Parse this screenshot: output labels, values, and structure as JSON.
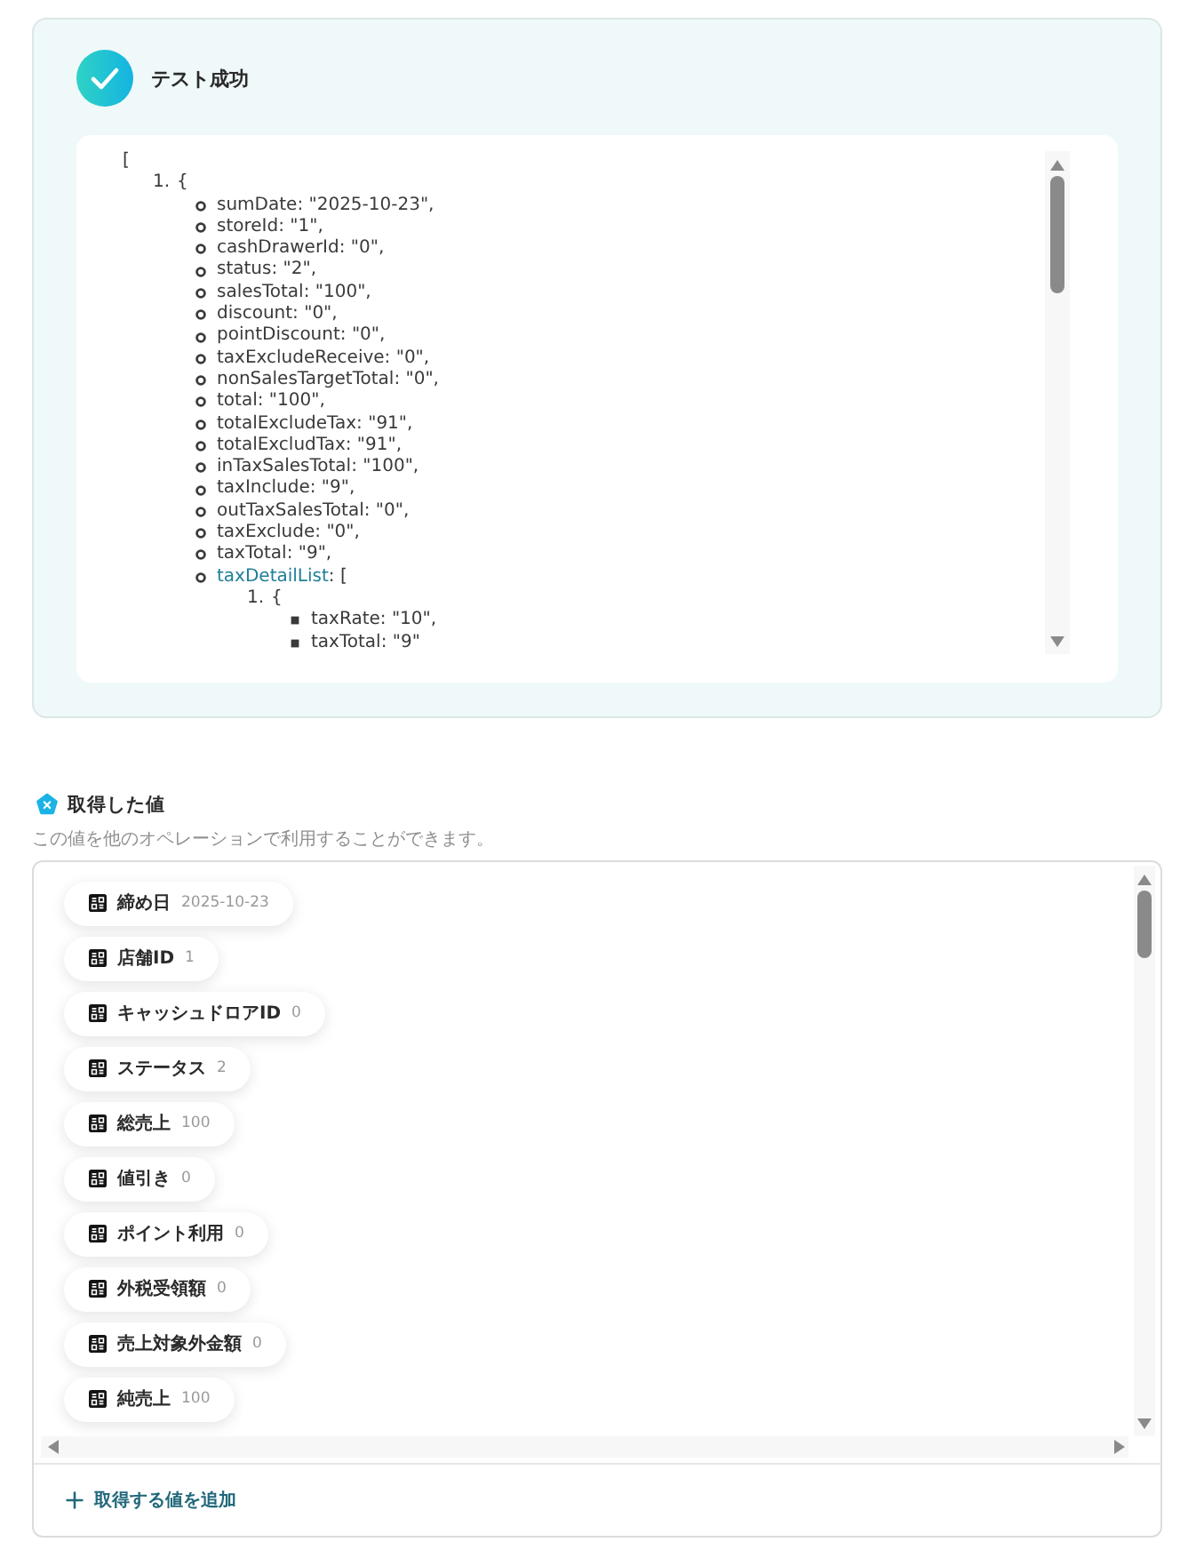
{
  "test_result": {
    "success": true,
    "title": "テスト成功",
    "output": [
      {
        "text": "[",
        "children": [
          {
            "marker": "1.",
            "text": "{",
            "children": [
              {
                "text": "sumDate: \"2025-10-23\","
              },
              {
                "text": "storeId: \"1\","
              },
              {
                "text": "cashDrawerId: \"0\","
              },
              {
                "text": "status: \"2\","
              },
              {
                "text": "salesTotal: \"100\","
              },
              {
                "text": "discount: \"0\","
              },
              {
                "text": "pointDiscount: \"0\","
              },
              {
                "text": "taxExcludeReceive: \"0\","
              },
              {
                "text": "nonSalesTargetTotal: \"0\","
              },
              {
                "text": "total: \"100\","
              },
              {
                "text": "totalExcludeTax: \"91\","
              },
              {
                "text": "totalExcludTax: \"91\","
              },
              {
                "text": "inTaxSalesTotal: \"100\","
              },
              {
                "text": "taxInclude: \"9\","
              },
              {
                "text": "outTaxSalesTotal: \"0\","
              },
              {
                "text": "taxExclude: \"0\","
              },
              {
                "text": "taxTotal: \"9\","
              },
              {
                "link": "taxDetailList",
                "text": ": [",
                "children": [
                  {
                    "marker": "1.",
                    "text": "{",
                    "children": [
                      {
                        "text": "taxRate: \"10\","
                      },
                      {
                        "text": "taxTotal: \"9\""
                      }
                    ]
                  }
                ]
              }
            ]
          }
        ]
      }
    ]
  },
  "acquired_values": {
    "title": "取得した値",
    "description": "この値を他のオペレーションで利用することができます。",
    "items": [
      {
        "label": "締め日",
        "value": "2025-10-23"
      },
      {
        "label": "店舗ID",
        "value": "1"
      },
      {
        "label": "キャッシュドロアID",
        "value": "0"
      },
      {
        "label": "ステータス",
        "value": "2"
      },
      {
        "label": "総売上",
        "value": "100"
      },
      {
        "label": "値引き",
        "value": "0"
      },
      {
        "label": "ポイント利用",
        "value": "0"
      },
      {
        "label": "外税受領額",
        "value": "0"
      },
      {
        "label": "売上対象外金額",
        "value": "0"
      },
      {
        "label": "純売上",
        "value": "100"
      }
    ],
    "add_button": "取得する値を追加"
  }
}
